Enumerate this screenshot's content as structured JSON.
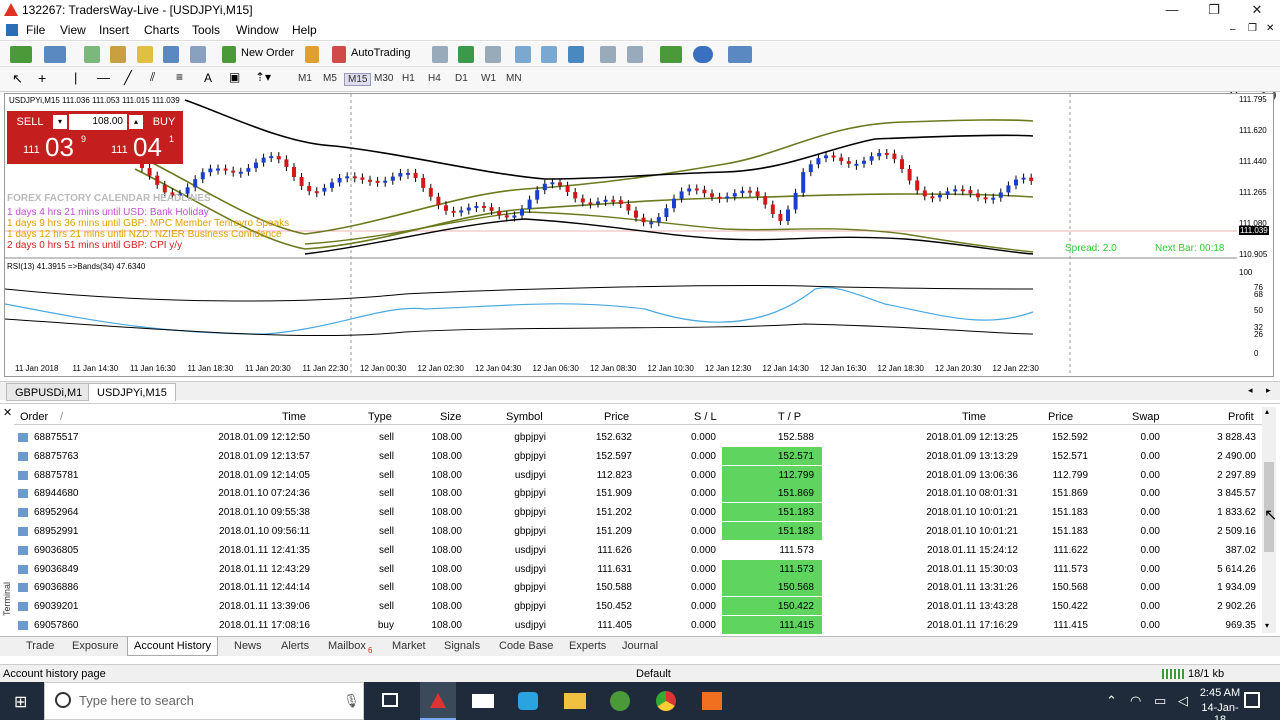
{
  "window": {
    "title": "132267: TradersWay-Live - [USDJPYi,M15]",
    "minimize": "—",
    "restore": "❐",
    "close": "✕"
  },
  "menu": [
    "File",
    "View",
    "Insert",
    "Charts",
    "Tools",
    "Window",
    "Help"
  ],
  "toolbar": {
    "new_order": "New Order",
    "auto_trading": "AutoTrading"
  },
  "timeframes": [
    "M1",
    "M5",
    "M15",
    "M30",
    "H1",
    "H4",
    "D1",
    "W1",
    "MN"
  ],
  "chart": {
    "header": "USDJPYi,M15  111.036 111.053 111.015 111.039",
    "sell_label": "SELL",
    "buy_label": "BUY",
    "lot": "108.00",
    "sell_big": "03",
    "sell_prefix": "111",
    "sell_sup": "9",
    "buy_big": "04",
    "buy_prefix": "111",
    "buy_sup": "1",
    "calendar_header": "FOREX FACTORY CALENDAR HEADLINES",
    "calendar_items": [
      {
        "text": "1 days 4 hrs 21 mins until USD: Bank Holiday",
        "color": "#c050d0"
      },
      {
        "text": "1 days 9 hrs 36 mins until GBP: MPC Member Tenreyro Speaks",
        "color": "#e0a000"
      },
      {
        "text": "1 days 12 hrs 21 mins until NZD: NZIER Business Confidence",
        "color": "#e0a000"
      },
      {
        "text": "2 days 0 hrs 51 mins until GBP: CPI y/y",
        "color": "#d02020"
      }
    ],
    "spread": "Spread: 2.0",
    "next_bar": "Next Bar: 00:18",
    "rsi_label": "RSI(13) 41.3915  =>Bands(34) 47.6340",
    "price_ticks": [
      "111.795",
      "111.620",
      "111.440",
      "111.265",
      "111.080",
      "111.039",
      "110.905"
    ],
    "current_price": "111.039",
    "rsi_ticks": [
      "100",
      "76",
      "68",
      "50",
      "32",
      "26",
      "0"
    ],
    "time_ticks": [
      "11 Jan 2018",
      "11 Jan 14:30",
      "11 Jan 16:30",
      "11 Jan 18:30",
      "11 Jan 20:30",
      "11 Jan 22:30",
      "12 Jan 00:30",
      "12 Jan 02:30",
      "12 Jan 04:30",
      "12 Jan 06:30",
      "12 Jan 08:30",
      "12 Jan 10:30",
      "12 Jan 12:30",
      "12 Jan 14:30",
      "12 Jan 16:30",
      "12 Jan 18:30",
      "12 Jan 20:30",
      "12 Jan 22:30"
    ]
  },
  "chart_tabs": [
    "GBPUSDi,M1",
    "USDJPYi,M15"
  ],
  "table": {
    "headers": [
      "Order",
      "Time",
      "Type",
      "Size",
      "Symbol",
      "Price",
      "S / L",
      "T / P",
      "Time",
      "Price",
      "Swap",
      "Profit"
    ],
    "sort_mark": "/",
    "rows": [
      {
        "order": "68875517",
        "time": "2018.01.09 12:12:50",
        "type": "sell",
        "size": "108.00",
        "symbol": "gbpjpyi",
        "price": "152.632",
        "sl": "0.000",
        "tp": "152.588",
        "hl": false,
        "ctime": "2018.01.09 12:13:25",
        "cprice": "152.592",
        "swap": "0.00",
        "profit": "3 828.43"
      },
      {
        "order": "68875763",
        "time": "2018.01.09 12:13:57",
        "type": "sell",
        "size": "108.00",
        "symbol": "gbpjpyi",
        "price": "152.597",
        "sl": "0.000",
        "tp": "152.571",
        "hl": true,
        "ctime": "2018.01.09 13:13:29",
        "cprice": "152.571",
        "swap": "0.00",
        "profit": "2 490.00"
      },
      {
        "order": "68875781",
        "time": "2018.01.09 12:14:05",
        "type": "sell",
        "size": "108.00",
        "symbol": "usdjpyi",
        "price": "112.823",
        "sl": "0.000",
        "tp": "112.799",
        "hl": true,
        "ctime": "2018.01.09 13:06:36",
        "cprice": "112.799",
        "swap": "0.00",
        "profit": "2 297.89"
      },
      {
        "order": "68944680",
        "time": "2018.01.10 07:24:36",
        "type": "sell",
        "size": "108.00",
        "symbol": "gbpjpyi",
        "price": "151.909",
        "sl": "0.000",
        "tp": "151.869",
        "hl": true,
        "ctime": "2018.01.10 08:01:31",
        "cprice": "151.869",
        "swap": "0.00",
        "profit": "3 845.57"
      },
      {
        "order": "68952964",
        "time": "2018.01.10 09:55:38",
        "type": "sell",
        "size": "108.00",
        "symbol": "gbpjpyi",
        "price": "151.202",
        "sl": "0.000",
        "tp": "151.183",
        "hl": true,
        "ctime": "2018.01.10 10:01:21",
        "cprice": "151.183",
        "swap": "0.00",
        "profit": "1 833.62"
      },
      {
        "order": "68952991",
        "time": "2018.01.10 09:56:11",
        "type": "sell",
        "size": "108.00",
        "symbol": "gbpjpyi",
        "price": "151.209",
        "sl": "0.000",
        "tp": "151.183",
        "hl": true,
        "ctime": "2018.01.10 10:01:21",
        "cprice": "151.183",
        "swap": "0.00",
        "profit": "2 509.16"
      },
      {
        "order": "69036805",
        "time": "2018.01.11 12:41:35",
        "type": "sell",
        "size": "108.00",
        "symbol": "usdjpyi",
        "price": "111.626",
        "sl": "0.000",
        "tp": "111.573",
        "hl": false,
        "ctime": "2018.01.11 15:24:12",
        "cprice": "111.622",
        "swap": "0.00",
        "profit": "387.02"
      },
      {
        "order": "69036849",
        "time": "2018.01.11 12:43:29",
        "type": "sell",
        "size": "108.00",
        "symbol": "usdjpyi",
        "price": "111.631",
        "sl": "0.000",
        "tp": "111.573",
        "hl": true,
        "ctime": "2018.01.11 15:30:03",
        "cprice": "111.573",
        "swap": "0.00",
        "profit": "5 614.26"
      },
      {
        "order": "69036886",
        "time": "2018.01.11 12:44:14",
        "type": "sell",
        "size": "108.00",
        "symbol": "gbpjpyi",
        "price": "150.588",
        "sl": "0.000",
        "tp": "150.568",
        "hl": true,
        "ctime": "2018.01.11 13:31:26",
        "cprice": "150.568",
        "swap": "0.00",
        "profit": "1 934.09"
      },
      {
        "order": "69039201",
        "time": "2018.01.11 13:39:06",
        "type": "sell",
        "size": "108.00",
        "symbol": "gbpjpyi",
        "price": "150.452",
        "sl": "0.000",
        "tp": "150.422",
        "hl": true,
        "ctime": "2018.01.11 13:43:28",
        "cprice": "150.422",
        "swap": "0.00",
        "profit": "2 902.26"
      },
      {
        "order": "69057860",
        "time": "2018.01.11 17:08:16",
        "type": "buy",
        "size": "108.00",
        "symbol": "usdjpyi",
        "price": "111.405",
        "sl": "0.000",
        "tp": "111.415",
        "hl": true,
        "ctime": "2018.01.11 17:16:29",
        "cprice": "111.415",
        "swap": "0.00",
        "profit": "969.35"
      }
    ]
  },
  "bottom_tabs": [
    "Trade",
    "Exposure",
    "Account History",
    "News",
    "Alerts",
    "Mailbox",
    "Market",
    "Signals",
    "Code Base",
    "Experts",
    "Journal"
  ],
  "mailbox_badge": "6",
  "terminal_label": "Terminal",
  "status": {
    "left": "Account history page",
    "profile": "Default",
    "traffic": "18/1 kb"
  },
  "taskbar": {
    "search_placeholder": "Type here to search",
    "time": "2:45 AM",
    "date": "14-Jan-18"
  },
  "colors": {
    "tp_highlight": "#5fd45f",
    "sell_panel": "#d42a2a",
    "band_color": "#6b7a1e"
  }
}
